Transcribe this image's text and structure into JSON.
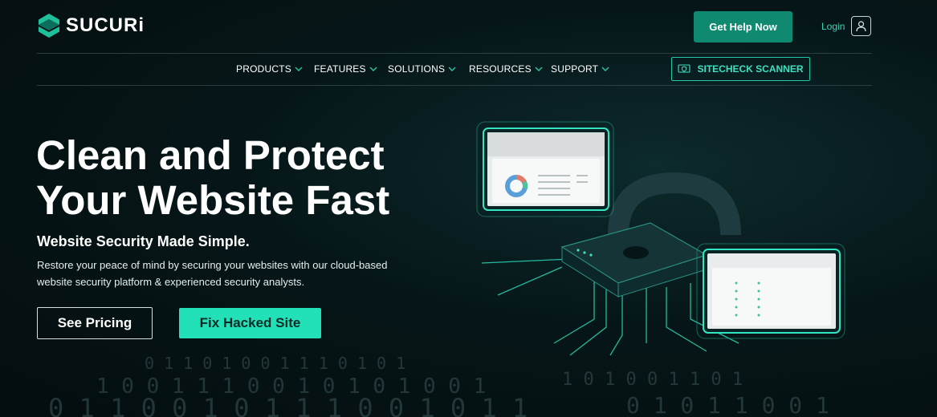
{
  "header": {
    "logo_text": "SUCURi",
    "help_button": "Get Help Now",
    "login": "Login"
  },
  "nav": {
    "items": [
      {
        "label": "PRODUCTS"
      },
      {
        "label": "FEATURES"
      },
      {
        "label": "SOLUTIONS"
      },
      {
        "label": "RESOURCES"
      },
      {
        "label": "SUPPORT"
      }
    ],
    "sitecheck": "SITECHECK SCANNER"
  },
  "hero": {
    "title_line1": "Clean and Protect",
    "title_line2": "Your Website Fast",
    "subtitle": "Website Security Made Simple.",
    "description": "Restore your peace of mind by securing your websites with our cloud-based website security platform & experienced security analysts.",
    "pricing_button": "See Pricing",
    "fix_button": "Fix Hacked Site"
  },
  "colors": {
    "accent": "#22e0b8",
    "help_button_bg": "#0f8a71",
    "background": "#061618"
  }
}
